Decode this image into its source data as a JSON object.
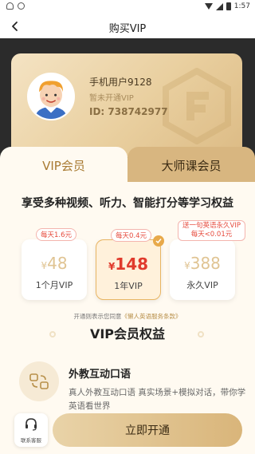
{
  "statusbar": {
    "time": "1:57"
  },
  "header": {
    "title": "购买VIP"
  },
  "user": {
    "name": "手机用户9128",
    "status": "暂未开通VIP",
    "id": "ID: 738742977"
  },
  "tabs": [
    {
      "label": "VIP会员"
    },
    {
      "label": "大师课会员"
    }
  ],
  "benefits_line": "享受多种视频、听力、智能打分等学习权益",
  "plans": [
    {
      "tag": "每天1.6元",
      "currency": "¥",
      "price": "48",
      "name": "1个月VIP"
    },
    {
      "tag": "每天0.4元",
      "currency": "¥",
      "price": "148",
      "name": "1年VIP",
      "selected": true
    },
    {
      "tag_line1": "送一句英语永久VIP",
      "tag_line2": "每天<0.01元",
      "currency": "¥",
      "price": "388",
      "name": "永久VIP"
    }
  ],
  "agreement": {
    "text": "开通则表示您同意",
    "link": "《懒人英语服务条款》"
  },
  "section_title": "VIP会员权益",
  "feature": {
    "title": "外教互动口语",
    "description": "真人外教互动口语 真实场景+模拟对话，带你学英语看世界"
  },
  "bottom": {
    "support_label": "联系客服",
    "open_button": "立即开通"
  },
  "colors": {
    "gold_card": "#e9cf9f",
    "dark_bg": "#2b2b2b",
    "accent_red": "#e03a2c",
    "button_gold": "#d9b57a"
  }
}
